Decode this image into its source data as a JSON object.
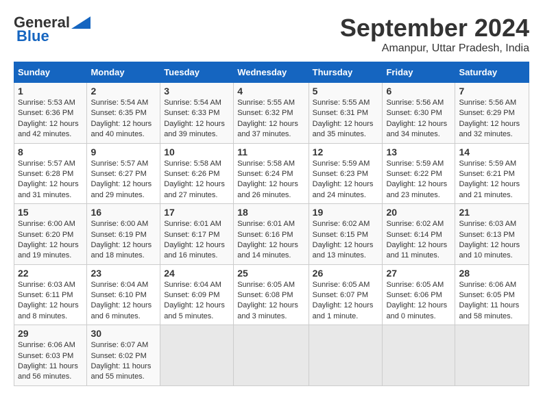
{
  "header": {
    "logo_general": "General",
    "logo_blue": "Blue",
    "month": "September 2024",
    "location": "Amanpur, Uttar Pradesh, India"
  },
  "columns": [
    "Sunday",
    "Monday",
    "Tuesday",
    "Wednesday",
    "Thursday",
    "Friday",
    "Saturday"
  ],
  "weeks": [
    [
      {
        "day": "1",
        "info": "Sunrise: 5:53 AM\nSunset: 6:36 PM\nDaylight: 12 hours\nand 42 minutes."
      },
      {
        "day": "2",
        "info": "Sunrise: 5:54 AM\nSunset: 6:35 PM\nDaylight: 12 hours\nand 40 minutes."
      },
      {
        "day": "3",
        "info": "Sunrise: 5:54 AM\nSunset: 6:33 PM\nDaylight: 12 hours\nand 39 minutes."
      },
      {
        "day": "4",
        "info": "Sunrise: 5:55 AM\nSunset: 6:32 PM\nDaylight: 12 hours\nand 37 minutes."
      },
      {
        "day": "5",
        "info": "Sunrise: 5:55 AM\nSunset: 6:31 PM\nDaylight: 12 hours\nand 35 minutes."
      },
      {
        "day": "6",
        "info": "Sunrise: 5:56 AM\nSunset: 6:30 PM\nDaylight: 12 hours\nand 34 minutes."
      },
      {
        "day": "7",
        "info": "Sunrise: 5:56 AM\nSunset: 6:29 PM\nDaylight: 12 hours\nand 32 minutes."
      }
    ],
    [
      {
        "day": "8",
        "info": "Sunrise: 5:57 AM\nSunset: 6:28 PM\nDaylight: 12 hours\nand 31 minutes."
      },
      {
        "day": "9",
        "info": "Sunrise: 5:57 AM\nSunset: 6:27 PM\nDaylight: 12 hours\nand 29 minutes."
      },
      {
        "day": "10",
        "info": "Sunrise: 5:58 AM\nSunset: 6:26 PM\nDaylight: 12 hours\nand 27 minutes."
      },
      {
        "day": "11",
        "info": "Sunrise: 5:58 AM\nSunset: 6:24 PM\nDaylight: 12 hours\nand 26 minutes."
      },
      {
        "day": "12",
        "info": "Sunrise: 5:59 AM\nSunset: 6:23 PM\nDaylight: 12 hours\nand 24 minutes."
      },
      {
        "day": "13",
        "info": "Sunrise: 5:59 AM\nSunset: 6:22 PM\nDaylight: 12 hours\nand 23 minutes."
      },
      {
        "day": "14",
        "info": "Sunrise: 5:59 AM\nSunset: 6:21 PM\nDaylight: 12 hours\nand 21 minutes."
      }
    ],
    [
      {
        "day": "15",
        "info": "Sunrise: 6:00 AM\nSunset: 6:20 PM\nDaylight: 12 hours\nand 19 minutes."
      },
      {
        "day": "16",
        "info": "Sunrise: 6:00 AM\nSunset: 6:19 PM\nDaylight: 12 hours\nand 18 minutes."
      },
      {
        "day": "17",
        "info": "Sunrise: 6:01 AM\nSunset: 6:17 PM\nDaylight: 12 hours\nand 16 minutes."
      },
      {
        "day": "18",
        "info": "Sunrise: 6:01 AM\nSunset: 6:16 PM\nDaylight: 12 hours\nand 14 minutes."
      },
      {
        "day": "19",
        "info": "Sunrise: 6:02 AM\nSunset: 6:15 PM\nDaylight: 12 hours\nand 13 minutes."
      },
      {
        "day": "20",
        "info": "Sunrise: 6:02 AM\nSunset: 6:14 PM\nDaylight: 12 hours\nand 11 minutes."
      },
      {
        "day": "21",
        "info": "Sunrise: 6:03 AM\nSunset: 6:13 PM\nDaylight: 12 hours\nand 10 minutes."
      }
    ],
    [
      {
        "day": "22",
        "info": "Sunrise: 6:03 AM\nSunset: 6:11 PM\nDaylight: 12 hours\nand 8 minutes."
      },
      {
        "day": "23",
        "info": "Sunrise: 6:04 AM\nSunset: 6:10 PM\nDaylight: 12 hours\nand 6 minutes."
      },
      {
        "day": "24",
        "info": "Sunrise: 6:04 AM\nSunset: 6:09 PM\nDaylight: 12 hours\nand 5 minutes."
      },
      {
        "day": "25",
        "info": "Sunrise: 6:05 AM\nSunset: 6:08 PM\nDaylight: 12 hours\nand 3 minutes."
      },
      {
        "day": "26",
        "info": "Sunrise: 6:05 AM\nSunset: 6:07 PM\nDaylight: 12 hours\nand 1 minute."
      },
      {
        "day": "27",
        "info": "Sunrise: 6:05 AM\nSunset: 6:06 PM\nDaylight: 12 hours\nand 0 minutes."
      },
      {
        "day": "28",
        "info": "Sunrise: 6:06 AM\nSunset: 6:05 PM\nDaylight: 11 hours\nand 58 minutes."
      }
    ],
    [
      {
        "day": "29",
        "info": "Sunrise: 6:06 AM\nSunset: 6:03 PM\nDaylight: 11 hours\nand 56 minutes."
      },
      {
        "day": "30",
        "info": "Sunrise: 6:07 AM\nSunset: 6:02 PM\nDaylight: 11 hours\nand 55 minutes."
      },
      {
        "day": "",
        "info": ""
      },
      {
        "day": "",
        "info": ""
      },
      {
        "day": "",
        "info": ""
      },
      {
        "day": "",
        "info": ""
      },
      {
        "day": "",
        "info": ""
      }
    ]
  ]
}
